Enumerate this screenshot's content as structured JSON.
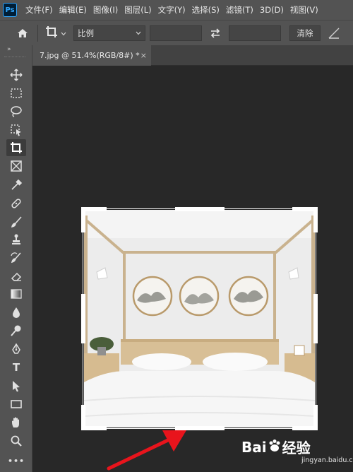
{
  "app": {
    "logo": "Ps"
  },
  "menu": [
    "文件(F)",
    "编辑(E)",
    "图像(I)",
    "图层(L)",
    "文字(Y)",
    "选择(S)",
    "滤镜(T)",
    "3D(D)",
    "视图(V)"
  ],
  "options_bar": {
    "home_icon": "home-icon",
    "crop_tool_icon": "crop-icon",
    "ratio_select": "比例",
    "width_value": "",
    "height_value": "",
    "swap_icon": "swap-arrows-icon",
    "clear_button": "清除"
  },
  "tab": {
    "title": "7.jpg @ 51.4%(RGB/8#) *",
    "close": "×"
  },
  "toolbar": {
    "collapse": "»",
    "tools": [
      "move",
      "marquee",
      "lasso",
      "object-select",
      "crop",
      "frame",
      "eyedropper",
      "healing",
      "brush",
      "stamp",
      "history-brush",
      "eraser",
      "gradient",
      "blur",
      "dodge",
      "pen",
      "text",
      "path-select",
      "rectangle",
      "hand",
      "zoom",
      "more"
    ],
    "text_tool_label": "T",
    "more_label": "•••"
  },
  "watermark": {
    "brand": "Bai",
    "brand_cn": "经验",
    "site": "jingyan.baidu.com"
  },
  "colors": {
    "menubar": "#535353",
    "canvas_bg": "#282828",
    "accent_blue": "#31a8ff",
    "arrow_red": "#e8141c",
    "crop_handle": "#ffffff"
  }
}
